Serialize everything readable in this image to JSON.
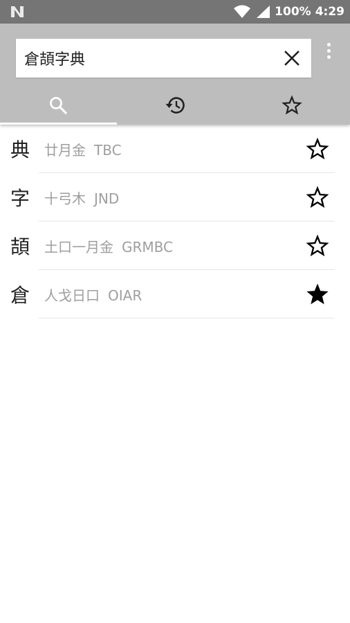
{
  "status_bar": {
    "battery": "100%",
    "time": "4:29"
  },
  "search": {
    "query": "倉頡字典",
    "placeholder": ""
  },
  "tabs": [
    {
      "icon": "search-icon",
      "active": true
    },
    {
      "icon": "history-icon",
      "active": false
    },
    {
      "icon": "star-outline-icon",
      "active": false
    }
  ],
  "results": [
    {
      "char": "典",
      "radicals": "廿月金",
      "code": "TBC",
      "starred": false
    },
    {
      "char": "字",
      "radicals": "十弓木",
      "code": "JND",
      "starred": false
    },
    {
      "char": "頡",
      "radicals": "土口一月金",
      "code": "GRMBC",
      "starred": false
    },
    {
      "char": "倉",
      "radicals": "人戈日口",
      "code": "OIAR",
      "starred": true
    }
  ],
  "colors": {
    "status_bar": "#757575",
    "header": "#bdbdbd",
    "secondary_text": "#9e9e9e"
  }
}
